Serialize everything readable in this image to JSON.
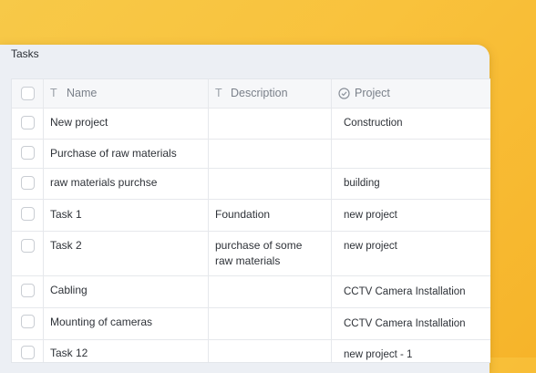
{
  "panel": {
    "title": "Tasks"
  },
  "columns": [
    {
      "label": "Name",
      "icon": "text-type-icon"
    },
    {
      "label": "Description",
      "icon": "text-type-icon"
    },
    {
      "label": "Project",
      "icon": "check-circle-icon"
    }
  ],
  "rows": [
    {
      "name": "New project",
      "description": "",
      "project": "Construction"
    },
    {
      "name": "Purchase of raw materials",
      "description": "",
      "project": ""
    },
    {
      "name": "raw materials purchse",
      "description": "",
      "project": "building"
    },
    {
      "name": "Task 1",
      "description": "Foundation",
      "project": "new project"
    },
    {
      "name": "Task 2",
      "description": "purchase of some\nraw materials",
      "project": "new project"
    },
    {
      "name": "Cabling",
      "description": "",
      "project": "CCTV Camera Installation"
    },
    {
      "name": "Mounting of cameras",
      "description": "",
      "project": "CCTV Camera Installation"
    },
    {
      "name": "Task 12",
      "description": "",
      "project": "new project - 1"
    }
  ]
}
